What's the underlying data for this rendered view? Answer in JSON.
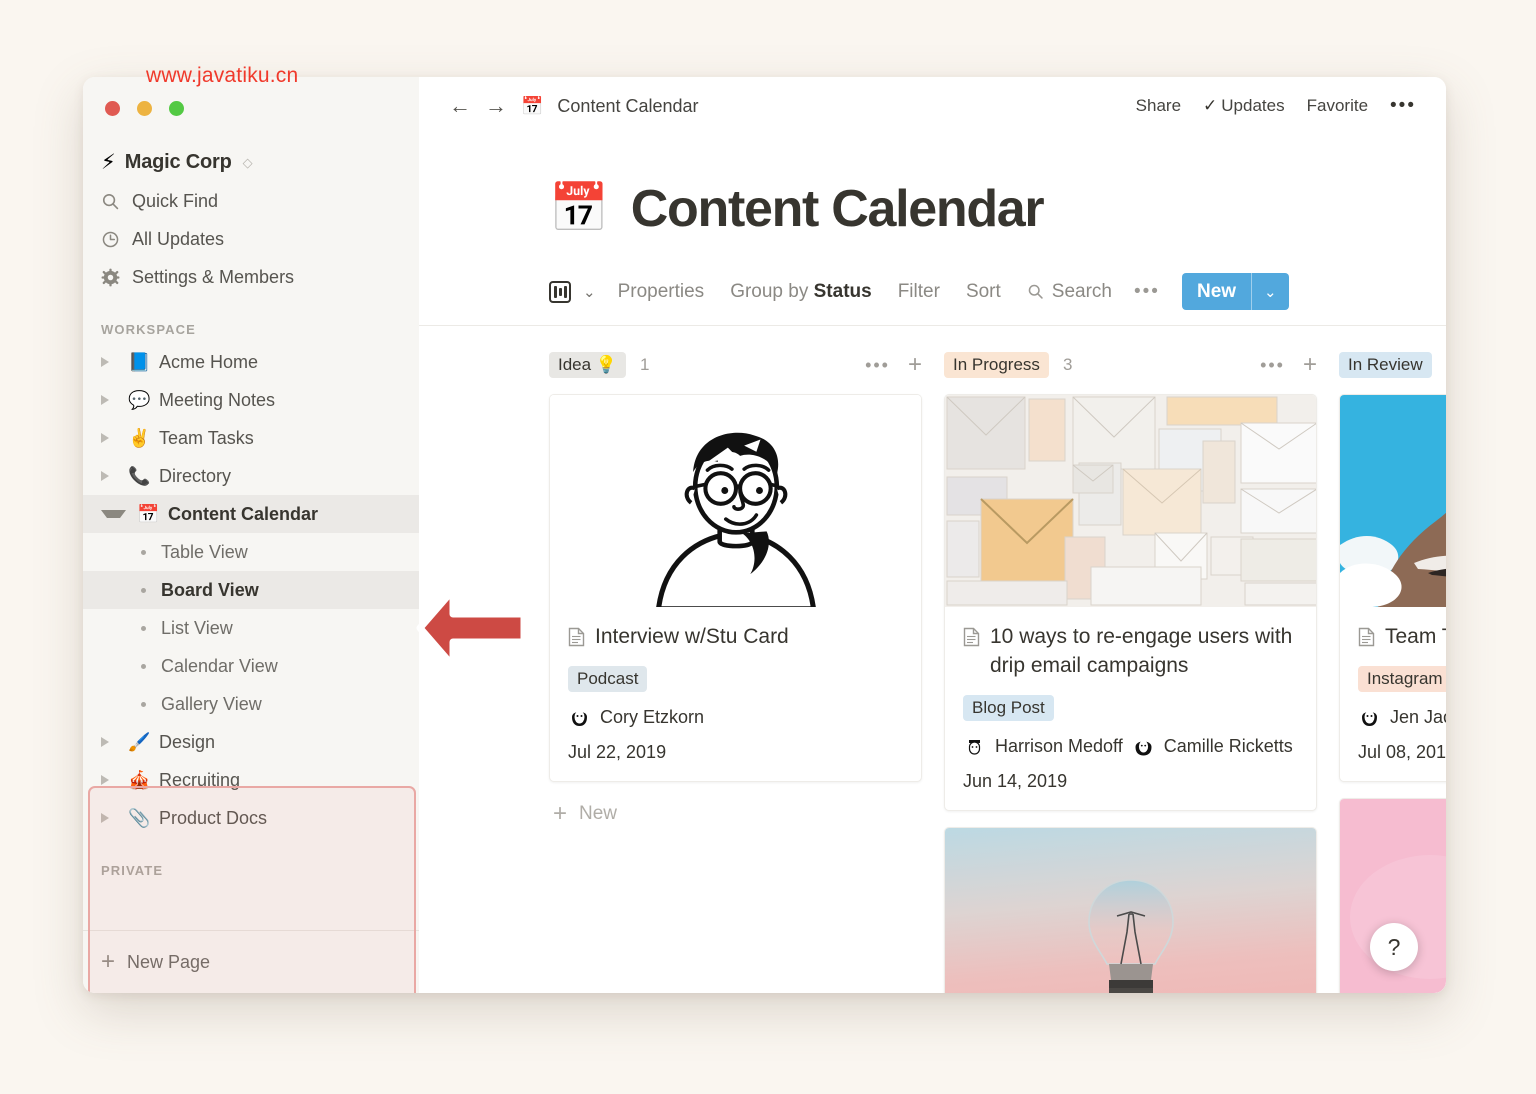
{
  "watermark": "www.javatiku.cn",
  "sidebar": {
    "workspace": {
      "name": "Magic Corp",
      "icon": "lightning-bolt"
    },
    "nav": [
      {
        "label": "Quick Find",
        "icon": "search-icon"
      },
      {
        "label": "All Updates",
        "icon": "clock-icon"
      },
      {
        "label": "Settings & Members",
        "icon": "gear-icon"
      }
    ],
    "section_workspace": "WORKSPACE",
    "section_private": "PRIVATE",
    "pages": [
      {
        "label": "Acme Home",
        "emoji": "📘",
        "expanded": false
      },
      {
        "label": "Meeting Notes",
        "emoji": "💬",
        "expanded": false
      },
      {
        "label": "Team Tasks",
        "emoji": "✌️",
        "expanded": false
      },
      {
        "label": "Directory",
        "emoji": "📞",
        "expanded": false
      },
      {
        "label": "Content Calendar",
        "emoji": "📅",
        "expanded": true
      }
    ],
    "views": [
      {
        "label": "Table View",
        "active": false
      },
      {
        "label": "Board View",
        "active": true
      },
      {
        "label": "List View",
        "active": false
      },
      {
        "label": "Calendar View",
        "active": false
      },
      {
        "label": "Gallery View",
        "active": false
      }
    ],
    "pages_after": [
      {
        "label": "Design",
        "emoji": "🖌️"
      },
      {
        "label": "Recruiting",
        "emoji": "🎪"
      },
      {
        "label": "Product Docs",
        "emoji": "📎"
      }
    ],
    "new_page": "New Page"
  },
  "topbar": {
    "breadcrumb": "Content Calendar",
    "breadcrumb_emoji": "📅",
    "share": "Share",
    "updates": "Updates",
    "favorite": "Favorite",
    "more": "•••"
  },
  "page": {
    "emoji": "📅",
    "title": "Content Calendar"
  },
  "viewbar": {
    "caret": "⌄",
    "properties": "Properties",
    "group_by_prefix": "Group by ",
    "group_by_value": "Status",
    "filter": "Filter",
    "sort": "Sort",
    "search": "Search",
    "more": "•••",
    "new_label": "New",
    "new_caret": "⌄",
    "accent_color": "#52a8dd"
  },
  "board": {
    "columns": [
      {
        "name": "Idea",
        "pill_emoji": "💡",
        "count": "1",
        "pill_color": "#e8e7e4",
        "new_label": "New",
        "cards": [
          {
            "title": "Interview w/Stu Card",
            "tag": "Podcast",
            "tag_color": "#dfe7ec",
            "people": [
              "Cory Etzkorn"
            ],
            "date": "Jul 22, 2019",
            "image": "line-art-portrait-man-glasses"
          }
        ]
      },
      {
        "name": "In Progress",
        "pill_emoji": "",
        "count": "3",
        "pill_color": "#fae5d3",
        "cards": [
          {
            "title": "10 ways to re-engage users with drip email campaigns",
            "tag": "Blog Post",
            "tag_color": "#d7e7f2",
            "people": [
              "Harrison Medoff",
              "Camille Ricketts"
            ],
            "date": "Jun 14, 2019",
            "image": "photo-white-envelopes-grid"
          },
          {
            "title": "",
            "tag": "",
            "people": [],
            "date": "",
            "image": "photo-hand-holding-lightbulb-sunset"
          }
        ]
      },
      {
        "name": "In Review",
        "pill_emoji": "",
        "count": "",
        "pill_color": "#d7e7f2",
        "cards": [
          {
            "title": "Team T",
            "tag": "Instagram",
            "tag_color": "#fae0d3",
            "people": [
              "Jen Jac"
            ],
            "date": "Jul 08, 201",
            "image": "photo-snowy-rock-cliff-blue-sky"
          },
          {
            "title": "",
            "tag": "",
            "people": [],
            "date": "",
            "image": "photo-pink-background-gold-objects"
          }
        ]
      }
    ]
  },
  "help_button": "?",
  "annotation": {
    "arrow_color": "#c9443f",
    "box_color": "#e9a8a4"
  }
}
